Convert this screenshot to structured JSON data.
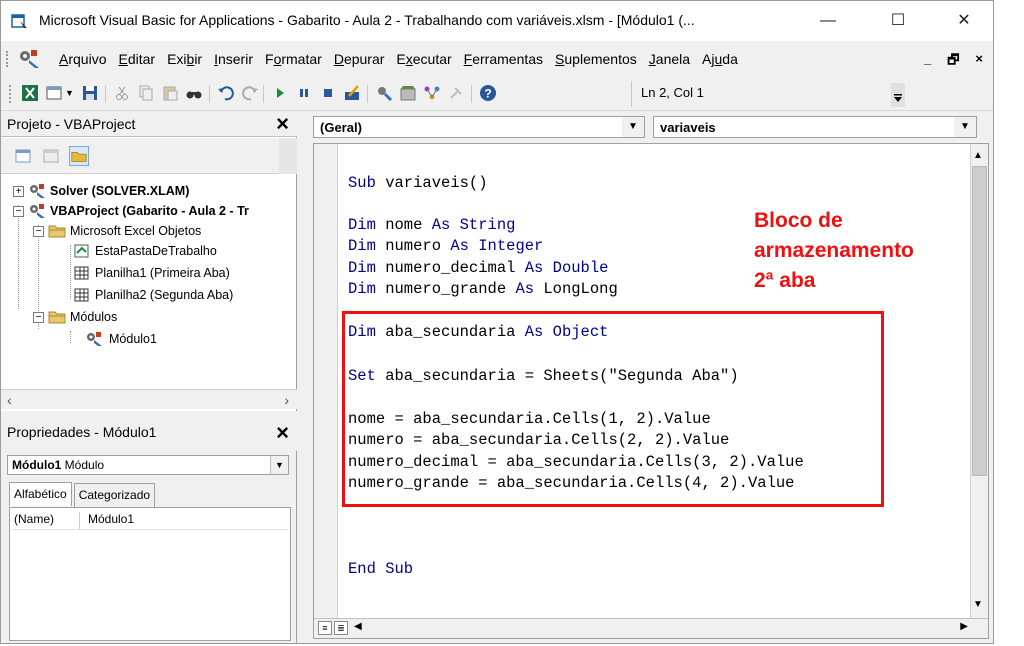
{
  "window": {
    "title": "Microsoft Visual Basic for Applications - Gabarito - Aula 2 - Trabalhando com variáveis.xlsm - [Módulo1 (...",
    "minimize": "—",
    "maximize": "☐",
    "close": "✕"
  },
  "menu": {
    "items": [
      {
        "u": "A",
        "rest": "rquivo"
      },
      {
        "u": "E",
        "rest": "ditar"
      },
      {
        "pre": "Exi",
        "u": "b",
        "rest": "ir"
      },
      {
        "u": "I",
        "rest": "nserir"
      },
      {
        "pre": "F",
        "u": "o",
        "rest": "rmatar"
      },
      {
        "u": "D",
        "rest": "epurar"
      },
      {
        "pre": "E",
        "u": "x",
        "rest": "ecutar"
      },
      {
        "u": "F",
        "rest": "erramentas"
      },
      {
        "u": "S",
        "rest": "uplementos"
      },
      {
        "u": "J",
        "rest": "anela"
      },
      {
        "pre": "Aj",
        "u": "u",
        "rest": "da"
      }
    ],
    "mdi_min": "_",
    "mdi_restore": "🗗",
    "mdi_close": "×"
  },
  "toolbar": {
    "status": "Ln 2, Col 1"
  },
  "project": {
    "title": "Projeto - VBAProject",
    "close": "×",
    "tree": {
      "solver": "Solver (SOLVER.XLAM)",
      "vbaproject": "VBAProject (Gabarito - Aula 2 - Tr",
      "excel_objects": "Microsoft Excel Objetos",
      "workbook": "EstaPastaDeTrabalho",
      "sheet1": "Planilha1 (Primeira Aba)",
      "sheet2": "Planilha2 (Segunda Aba)",
      "modules": "Módulos",
      "module1": "Módulo1"
    }
  },
  "properties": {
    "title": "Propriedades - Módulo1",
    "close": "×",
    "combo_name": "Módulo1",
    "combo_type": "Módulo",
    "tabs": [
      "Alfabético",
      "Categorizado"
    ],
    "rows": [
      {
        "name": "(Name)",
        "value": "Módulo1"
      }
    ]
  },
  "code": {
    "object_combo": "(Geral)",
    "proc_combo": "variaveis",
    "lines": {
      "l1_kw": "Sub",
      "l1_rest": " variaveis()",
      "l2_kw": "Dim",
      "l2_a": " nome ",
      "l2_as": "As",
      "l2_type": " String",
      "l3_kw": "Dim",
      "l3_a": " numero ",
      "l3_as": "As",
      "l3_type": " Integer",
      "l4_kw": "Dim",
      "l4_a": " numero_decimal ",
      "l4_as": "As",
      "l4_type": " Double",
      "l5_kw": "Dim",
      "l5_a": " numero_grande ",
      "l5_as": "As",
      "l5_type": " LongLong",
      "l6_kw": "Dim",
      "l6_a": " aba_secundaria ",
      "l6_as": "As",
      "l6_type": " Object",
      "l7_kw": "Set",
      "l7_rest": " aba_secundaria = Sheets(\"Segunda Aba\")",
      "l8": "nome = aba_secundaria.Cells(1, 2).Value",
      "l9": "numero = aba_secundaria.Cells(2, 2).Value",
      "l10": "numero_decimal = aba_secundaria.Cells(3, 2).Value",
      "l11": "numero_grande = aba_secundaria.Cells(4, 2).Value",
      "l12_kw": "End Sub"
    }
  },
  "annotation": {
    "line1": "Bloco de",
    "line2": "armazenamento",
    "line3": "2ª aba"
  },
  "colors": {
    "keyword": "#00008b",
    "annotation": "#e11111"
  }
}
